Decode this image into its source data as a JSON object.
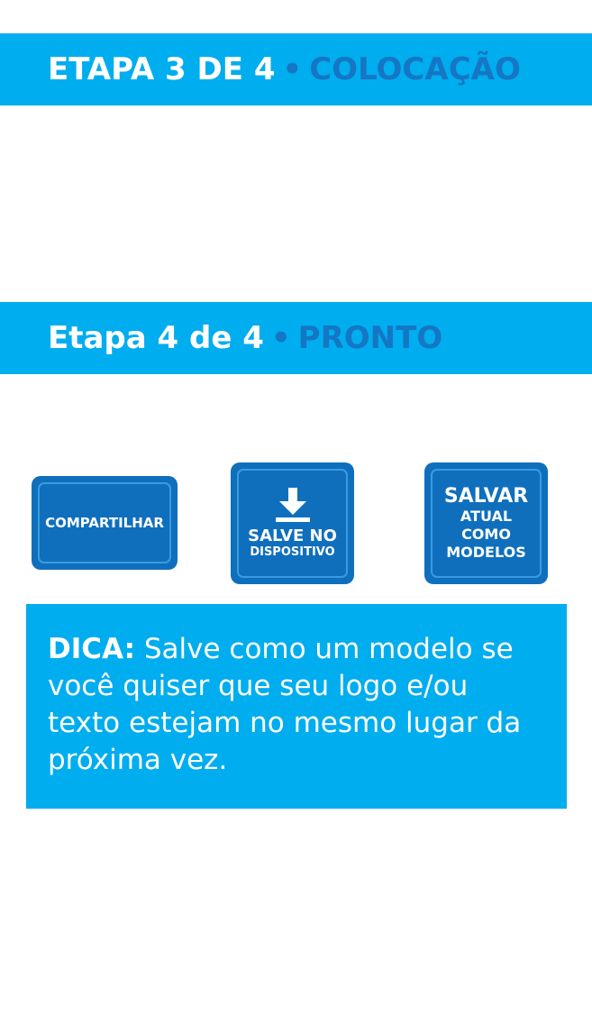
{
  "step3": {
    "lead": "ETAPA 3 DE 4",
    "dot": "•",
    "tail": "COLOCAÇÃO"
  },
  "step4": {
    "lead": "Etapa 4 de 4",
    "dot": "•",
    "tail": "PRONTO"
  },
  "actions": {
    "share_label": "COMPARTILHAR",
    "save_device": {
      "icon": "download-arrow-icon",
      "line1": "SALVE NO",
      "line2": "DISPOSITIVO"
    },
    "save_template": {
      "line1": "SALVAR",
      "line2": "ATUAL",
      "line3": "COMO",
      "line4": "MODELOS"
    }
  },
  "tip": {
    "label": "DICA:",
    "text": "Salve como um modelo se você quiser que seu logo e/ou texto estejam no mesmo lugar da próxima vez."
  },
  "colors": {
    "banner_bg": "#00adef",
    "accent_dark": "#1576c4",
    "button_bg": "#0f6fbd",
    "button_border": "#3a9be0"
  }
}
